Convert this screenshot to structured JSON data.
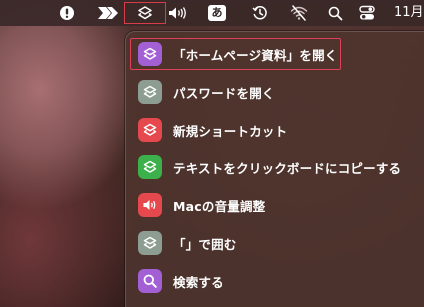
{
  "menubar": {
    "icons": [
      "info-icon",
      "arrow-forward-icon",
      "shortcuts-icon",
      "volume-icon",
      "input-method-icon",
      "time-machine-icon",
      "wifi-off-icon",
      "search-icon",
      "control-center-icon"
    ],
    "ime_label": "あ",
    "clock": "11月"
  },
  "menu": {
    "items": [
      {
        "label": "「ホームページ資料」を開く",
        "icon": "shortcuts-stack-icon",
        "color": "#a35fd4",
        "highlighted": true
      },
      {
        "label": "パスワードを開く",
        "icon": "shortcuts-stack-icon",
        "color": "#8e9d91"
      },
      {
        "label": "新規ショートカット",
        "icon": "shortcuts-stack-icon",
        "color": "#e5484d"
      },
      {
        "label": "テキストをクリックボードにコピーする",
        "icon": "shortcuts-stack-icon",
        "color": "#3cb04a"
      },
      {
        "label": "Macの音量調整",
        "icon": "speaker-icon",
        "color": "#e5484d"
      },
      {
        "label": "「」で囲む",
        "icon": "shortcuts-stack-icon",
        "color": "#8e9d91"
      },
      {
        "label": "検索する",
        "icon": "magnifier-icon",
        "color": "#a35fd4"
      }
    ]
  },
  "colors": {
    "highlight_border": "#e0405a",
    "menu_background": "#4e342e"
  }
}
